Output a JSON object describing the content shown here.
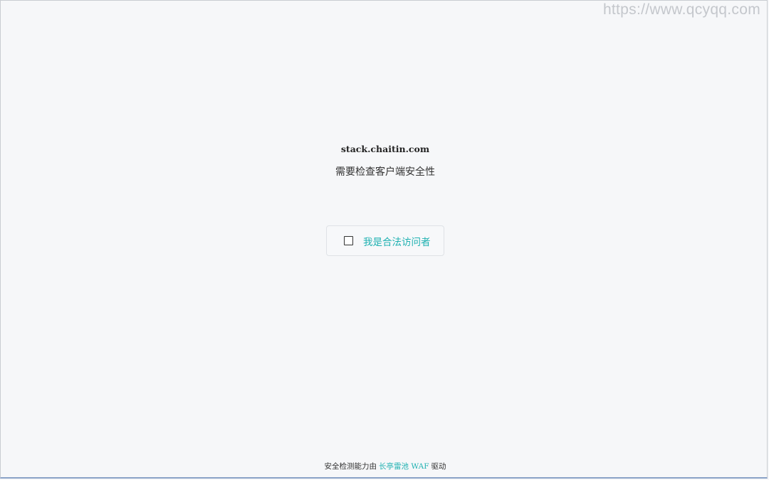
{
  "watermark": "https://www.qcyqq.com",
  "challenge": {
    "domain": "stack.chaitin.com",
    "subtitle": "需要检查客户端安全性",
    "checkbox_label": "我是合法访问者",
    "checkbox_checked": false
  },
  "footer": {
    "prefix": "安全检测能力由",
    "brand": "长亭雷池 WAF",
    "suffix": "驱动"
  },
  "colors": {
    "accent": "#1fb1b1",
    "background": "#f6f7f9"
  }
}
